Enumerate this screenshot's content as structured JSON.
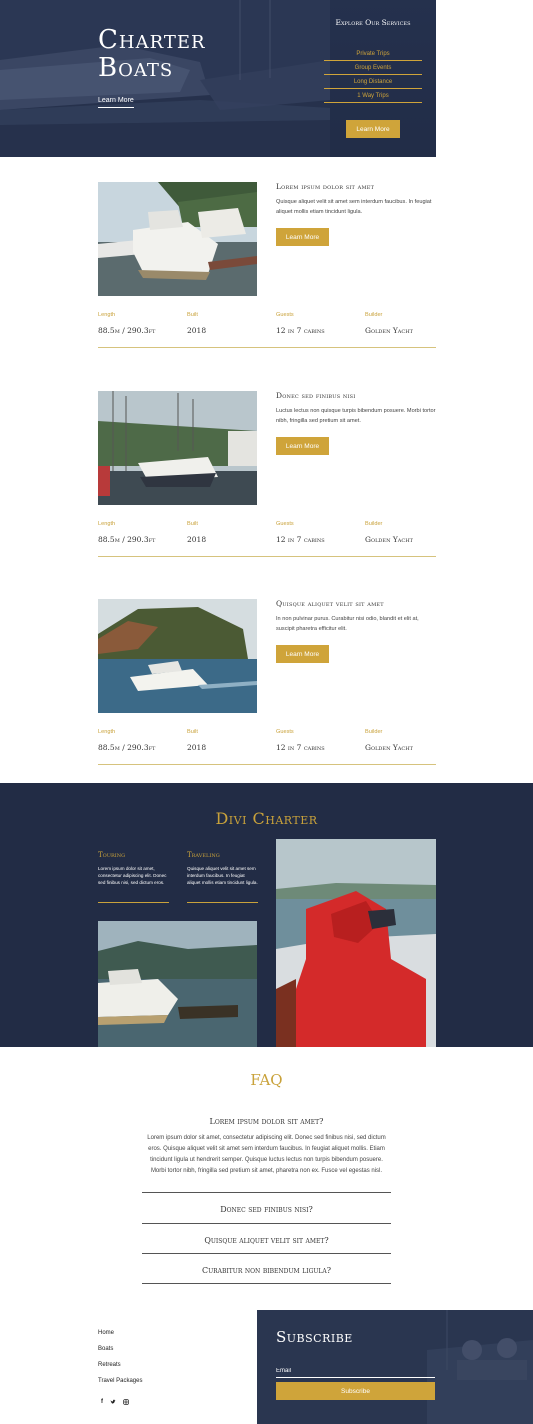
{
  "colors": {
    "navy": "#222c45",
    "gold": "#c9a23b",
    "white": "#ffffff"
  },
  "hero": {
    "title_line1": "Charter",
    "title_line2": "Boats",
    "learn_more": "Learn More",
    "services_title": "Explore Our Services",
    "services": [
      "Private Trips",
      "Group Events",
      "Long Distance",
      "1 Way Trips"
    ],
    "button": "Learn More"
  },
  "boats": [
    {
      "title": "Lorem ipsum dolor sit amet",
      "desc": "Quisque aliquet velit sit amet sem interdum faucibus. In feugiat aliquet mollis etiam tincidunt ligula.",
      "button": "Learn More",
      "specs": [
        {
          "label": "Length",
          "value": "88.5m / 290.3ft"
        },
        {
          "label": "Built",
          "value": "2018"
        },
        {
          "label": "Guests",
          "value": "12 in 7 cabins"
        },
        {
          "label": "Builder",
          "value": "Golden Yacht"
        }
      ]
    },
    {
      "title": "Donec sed finibus nisi",
      "desc": "Luctus lectus non quisque turpis bibendum posuere. Morbi tortor nibh, fringilla sed pretium sit amet.",
      "button": "Learn More",
      "specs": [
        {
          "label": "Length",
          "value": "88.5m / 290.3ft"
        },
        {
          "label": "Built",
          "value": "2018"
        },
        {
          "label": "Guests",
          "value": "12 in 7 cabins"
        },
        {
          "label": "Builder",
          "value": "Golden Yacht"
        }
      ]
    },
    {
      "title": "Quisque aliquet velit sit amet",
      "desc": "In non pulvinar purus. Curabitur nisi odio, blandit et elit at, suscipit pharetra efficitur elit.",
      "button": "Learn More",
      "specs": [
        {
          "label": "Length",
          "value": "88.5m / 290.3ft"
        },
        {
          "label": "Built",
          "value": "2018"
        },
        {
          "label": "Guests",
          "value": "12 in 7 cabins"
        },
        {
          "label": "Builder",
          "value": "Golden Yacht"
        }
      ]
    }
  ],
  "charter": {
    "title": "Divi Charter",
    "touring_title": "Touring",
    "touring_text": "Lorem ipsum dolor sit amet, consectetur adipiscing elit. Donec sed finibus nisi, sed dictum eros.",
    "traveling_title": "Traveling",
    "traveling_text": "Quisque aliquet velit sit amet sem interdum faucibus. In feugiat aliquet mollis etiam tincidunt ligula."
  },
  "faq": {
    "title": "FAQ",
    "open_question": "Lorem ipsum dolor sit amet?",
    "open_answer": "Lorem ipsum dolor sit amet, consectetur adipiscing elit. Donec sed finibus nisi, sed dictum eros. Quisque aliquet velit sit amet sem interdum faucibus. In feugiat aliquet mollis. Etiam tincidunt ligula ut hendrerit semper. Quisque luctus lectus non turpis bibendum posuere. Morbi tortor nibh, fringilla sed pretium sit amet, pharetra non ex. Fusce vel egestas nisl.",
    "questions": [
      "Donec sed finibus nisi?",
      "Quisque aliquet velit sit amet?",
      "Curabitur non bibendum ligula?"
    ]
  },
  "footer": {
    "links": [
      "Home",
      "Boats",
      "Retreats",
      "Travel Packages"
    ],
    "social_icons": [
      "facebook-icon",
      "twitter-icon",
      "instagram-icon"
    ]
  },
  "subscribe": {
    "title": "Subscribe",
    "email_placeholder": "Email",
    "button": "Subscribe"
  }
}
